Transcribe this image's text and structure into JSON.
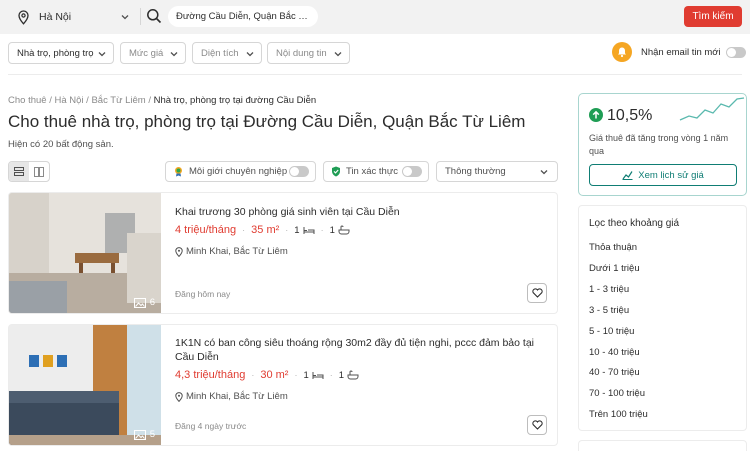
{
  "header": {
    "location": "Hà Nội",
    "search_value": "Đường Cầu Diễn, Quận Bắc Từ …",
    "search_button": "Tìm kiếm"
  },
  "filters": {
    "type": "Nhà trọ, phòng trọ",
    "price": "Mức giá",
    "area": "Diện tích",
    "content": "Nội dung tin",
    "email_alert": "Nhận email tin mới"
  },
  "breadcrumb": {
    "items": [
      "Cho thuê",
      "Hà Nội",
      "Bắc Từ Liêm"
    ],
    "current": "Nhà trọ, phòng trọ tại đường Cầu Diễn",
    "sep": "/"
  },
  "page": {
    "title": "Cho thuê nhà trọ, phòng trọ tại Đường Cầu Diễn, Quận Bắc Từ Liêm",
    "count": "Hiện có 20 bất động sản."
  },
  "toolbar": {
    "broker": "Môi giới chuyên nghiệp",
    "verified": "Tin xác thực",
    "sort": "Thông thường"
  },
  "listings": [
    {
      "title": "Khai trương 30 phòng giá sinh viên tại Cầu Diễn",
      "price": "4 triệu/tháng",
      "area": "35 m²",
      "beds": "1",
      "baths": "1",
      "location": "Minh Khai, Bắc Từ Liêm",
      "posted": "Đăng hôm nay",
      "photos": "6"
    },
    {
      "title": "1K1N có ban công siêu thoáng rộng 30m2 đầy đủ tiện nghi, pccc đảm bảo tại Cầu Diễn",
      "price": "4,3 triệu/tháng",
      "area": "30 m²",
      "beds": "1",
      "baths": "1",
      "location": "Minh Khai, Bắc Từ Liêm",
      "posted": "Đăng 4 ngày trước",
      "photos": "5"
    }
  ],
  "trend": {
    "percent": "10,5%",
    "description": "Giá thuê đã tăng trong vòng 1 năm qua",
    "button": "Xem lịch sử giá"
  },
  "price_filter": {
    "title": "Lọc theo khoảng giá",
    "items": [
      "Thỏa thuận",
      "Dưới 1 triệu",
      "1 - 3 triệu",
      "3 - 5 triệu",
      "5 - 10 triệu",
      "10 - 40 triệu",
      "40 - 70 triệu",
      "70 - 100 triệu",
      "Trên 100 triệu"
    ]
  },
  "colors": {
    "accent": "#e03c31",
    "teal": "#0f7d74"
  }
}
